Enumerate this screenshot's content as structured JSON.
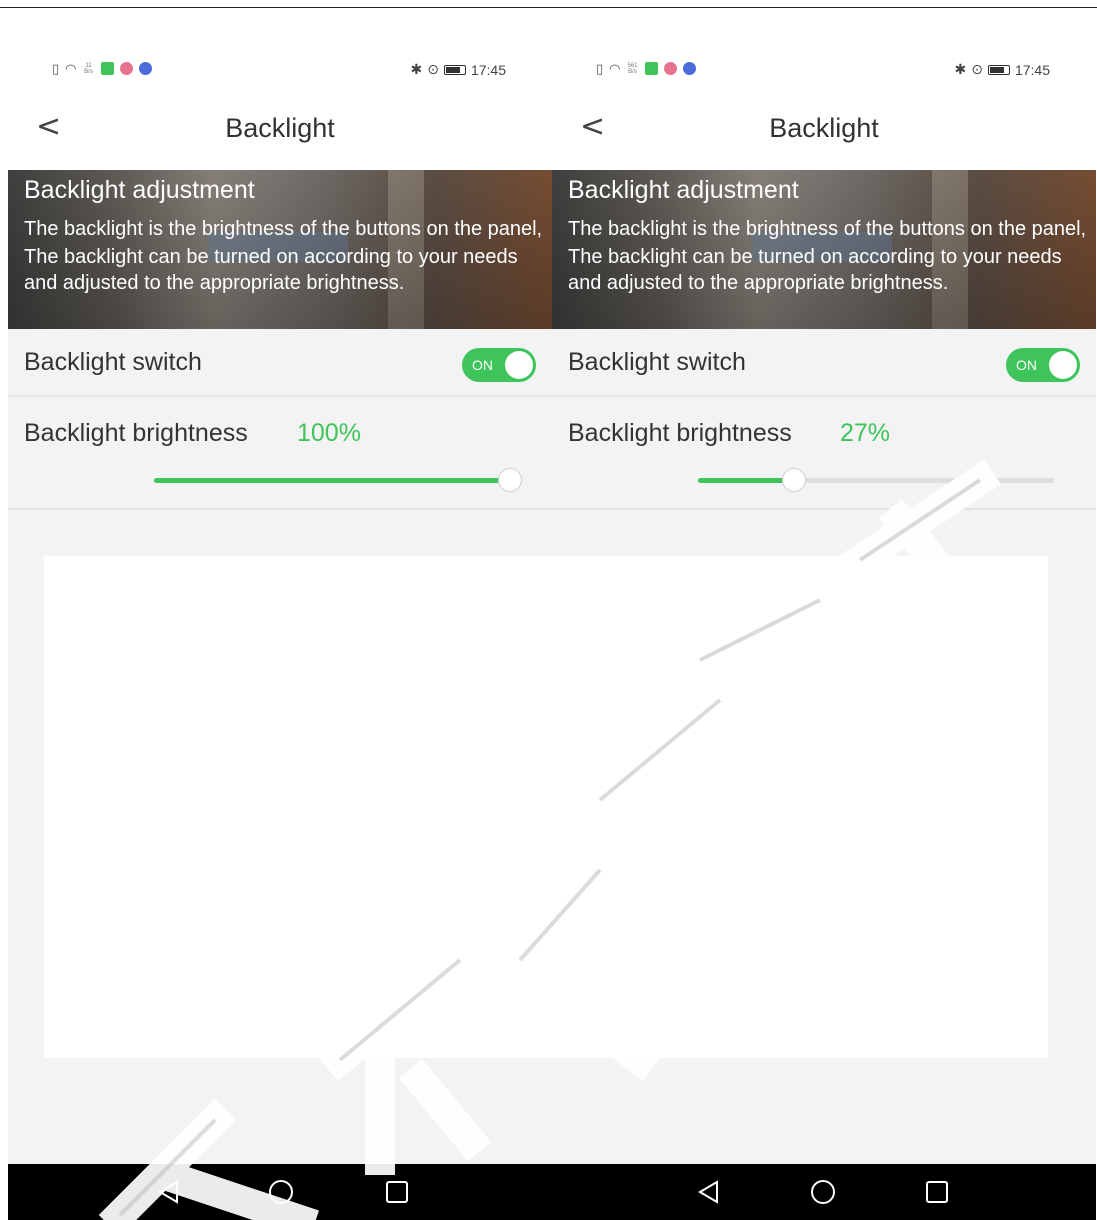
{
  "screens": [
    {
      "status": {
        "time": "17:45",
        "net_speed_top": "11",
        "net_speed_unit": "B/s"
      },
      "header": {
        "back_glyph": "<",
        "title": "Backlight"
      },
      "banner": {
        "title": "Backlight adjustment",
        "line1": "The backlight is the brightness of the buttons on the panel,",
        "line2": "The backlight can be turned on according to your needs and adjusted to the appropriate brightness."
      },
      "switch_row": {
        "label": "Backlight switch",
        "toggle_text": "ON",
        "toggle_on": true
      },
      "brightness_row": {
        "label": "Backlight brightness",
        "value_text": "100%",
        "value": 1.0
      }
    },
    {
      "status": {
        "time": "17:45",
        "net_speed_top": "561",
        "net_speed_unit": "B/s"
      },
      "header": {
        "back_glyph": "<",
        "title": "Backlight"
      },
      "banner": {
        "title": "Backlight adjustment",
        "line1": "The backlight is the brightness of the buttons on the panel,",
        "line2": "The backlight can be turned on according to your needs and adjusted to the appropriate brightness."
      },
      "switch_row": {
        "label": "Backlight switch",
        "toggle_text": "ON",
        "toggle_on": true
      },
      "brightness_row": {
        "label": "Backlight brightness",
        "value_text": "27%",
        "value": 0.27
      }
    }
  ],
  "colors": {
    "accent_green": "#3ec45a",
    "navbar": "#000000",
    "background": "#f3f3f3"
  },
  "icons": {
    "status_left": [
      "sim-icon",
      "wifi-icon",
      "net-speed-icon",
      "app-notification-icons"
    ],
    "status_right": [
      "bluetooth-icon",
      "location-icon",
      "battery-icon"
    ],
    "nav": [
      "back-triangle-icon",
      "home-circle-icon",
      "recent-square-icon"
    ]
  }
}
